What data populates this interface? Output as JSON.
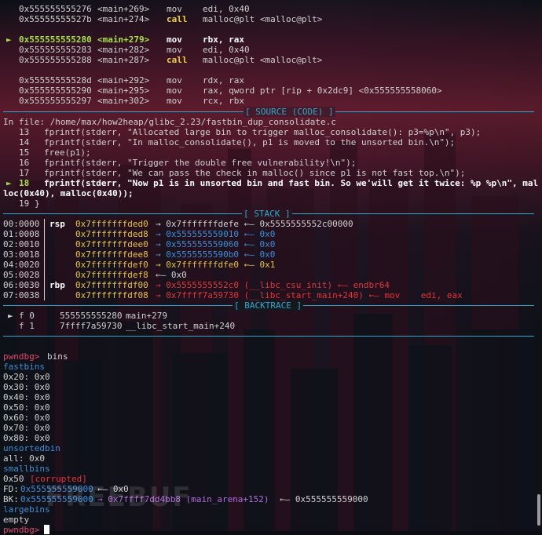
{
  "disasm": [
    {
      "arrow": "",
      "addr": "0x555555555276",
      "off": "<main+269>",
      "mn": "mov",
      "ops": "edi, 0x40",
      "cur": false
    },
    {
      "arrow": "",
      "addr": "0x55555555527b",
      "off": "<main+274>",
      "mn": "call",
      "ops": "malloc@plt <malloc@plt>",
      "cur": false
    },
    {
      "arrow": "",
      "addr": "",
      "off": "",
      "mn": "",
      "ops": "",
      "cur": false
    },
    {
      "arrow": "►",
      "addr": "0x555555555280",
      "off": "<main+279>",
      "mn": "mov",
      "ops": "rbx, rax",
      "cur": true
    },
    {
      "arrow": "",
      "addr": "0x555555555283",
      "off": "<main+282>",
      "mn": "mov",
      "ops": "edi, 0x40",
      "cur": false
    },
    {
      "arrow": "",
      "addr": "0x555555555288",
      "off": "<main+287>",
      "mn": "call",
      "ops": "malloc@plt <malloc@plt>",
      "cur": false
    },
    {
      "arrow": "",
      "addr": "",
      "off": "",
      "mn": "",
      "ops": "",
      "cur": false
    },
    {
      "arrow": "",
      "addr": "0x55555555528d",
      "off": "<main+292>",
      "mn": "mov",
      "ops": "rdx, rax",
      "cur": false
    },
    {
      "arrow": "",
      "addr": "0x555555555290",
      "off": "<main+295>",
      "mn": "mov",
      "ops": "rax, qword ptr [rip + 0x2dc9] <0x555555558060>",
      "cur": false
    },
    {
      "arrow": "",
      "addr": "0x555555555297",
      "off": "<main+302>",
      "mn": "mov",
      "ops": "rcx, rbx",
      "cur": false
    }
  ],
  "source": {
    "title": "[ SOURCE (CODE) ]",
    "file_line": "In file: /home/max/how2heap/glibc_2.23/fastbin_dup_consolidate.c",
    "lines": [
      {
        "arrow": "",
        "num": "13",
        "code": "fprintf(stderr, \"Allocated large bin to trigger malloc_consolidate(): p3=%p\\n\", p3);",
        "cur": false
      },
      {
        "arrow": "",
        "num": "14",
        "code": "fprintf(stderr, \"In malloc_consolidate(), p1 is moved to the unsorted bin.\\n\");",
        "cur": false
      },
      {
        "arrow": "",
        "num": "15",
        "code": "free(p1);",
        "cur": false
      },
      {
        "arrow": "",
        "num": "16",
        "code": "fprintf(stderr, \"Trigger the double free vulnerability!\\n\");",
        "cur": false
      },
      {
        "arrow": "",
        "num": "17",
        "code": "fprintf(stderr, \"We can pass the check in malloc() since p1 is not fast top.\\n\");",
        "cur": false
      },
      {
        "arrow": "►",
        "num": "18",
        "code": "fprintf(stderr, \"Now p1 is in unsorted bin and fast bin. So we'will get it twice: %p %p\\n\", mal",
        "cur": true
      },
      {
        "arrow": "",
        "num": "",
        "code": "loc(0x40), malloc(0x40));",
        "cur": true
      },
      {
        "arrow": "",
        "num": "19",
        "code": "}",
        "cur": false
      }
    ]
  },
  "stack": {
    "title": "[ STACK ]",
    "rows": [
      {
        "idx": "00:0000",
        "reg": "rsp",
        "addr": "0x7fffffffded0",
        "chain": "→ 0x7fffffffdefe ←— 0x5555555552c00000"
      },
      {
        "idx": "01:0008",
        "reg": "",
        "addr": "0x7fffffffded8",
        "chain": "→ 0x555555559010 ←— 0x0"
      },
      {
        "idx": "02:0010",
        "reg": "",
        "addr": "0x7fffffffdee0",
        "chain": "→ 0x555555559060 ←— 0x0"
      },
      {
        "idx": "03:0018",
        "reg": "",
        "addr": "0x7fffffffdee8",
        "chain": "→ 0x5555555590b0 ←— 0x0"
      },
      {
        "idx": "04:0020",
        "reg": "",
        "addr": "0x7fffffffdef0",
        "chain": "→ 0x7fffffffdfe0 ←— 0x1"
      },
      {
        "idx": "05:0028",
        "reg": "",
        "addr": "0x7fffffffdef8",
        "chain": "←— 0x0"
      },
      {
        "idx": "06:0030",
        "reg": "rbp",
        "addr": "0x7fffffffdf00",
        "chain": "→ 0x5555555552c0 (__libc_csu_init) ←— endbr64"
      },
      {
        "idx": "07:0038",
        "reg": "",
        "addr": "0x7fffffffdf08",
        "chain": "→ 0x7ffff7a59730 (__libc_start_main+240) ←— mov    edi, eax"
      }
    ]
  },
  "backtrace": {
    "title": "[ BACKTRACE ]",
    "frames": [
      {
        "arrow": "►",
        "frame": "f 0",
        "addr": "555555555280",
        "sym": "main+279"
      },
      {
        "arrow": "",
        "frame": "f 1",
        "addr": "7ffff7a59730",
        "sym": "__libc_start_main+240"
      }
    ]
  },
  "bins": {
    "prompt": "pwndbg>",
    "command": "bins",
    "fastbins_label": "fastbins",
    "fastbins": [
      "0x20: 0x0",
      "0x30: 0x0",
      "0x40: 0x0",
      "0x50: 0x0",
      "0x60: 0x0",
      "0x70: 0x0",
      "0x80: 0x0"
    ],
    "unsortedbin_label": "unsortedbin",
    "unsortedbin_all": "all: 0x0",
    "smallbins_label": "smallbins",
    "smallbin_size": "0x50",
    "smallbin_corrupted": "[corrupted]",
    "fd_label": "FD:",
    "fd_addr": "0x555555559000",
    "fd_rest": "←— 0x0",
    "bk_label": "BK:",
    "bk_addr": "0x555555559000",
    "bk_target": "→ 0x7ffff7dd4bb8 (main_arena+152)",
    "bk_rest": "←— 0x555555559000",
    "largebins_label": "largebins",
    "largebins_value": "empty",
    "final_prompt": "pwndbg>"
  },
  "watermark": "FREEBUF",
  "colors": {
    "separator": "#2fa8c8",
    "address": "#3c8ed8",
    "highlight": "#a8e04a",
    "keyword_call": "#e8c440"
  }
}
